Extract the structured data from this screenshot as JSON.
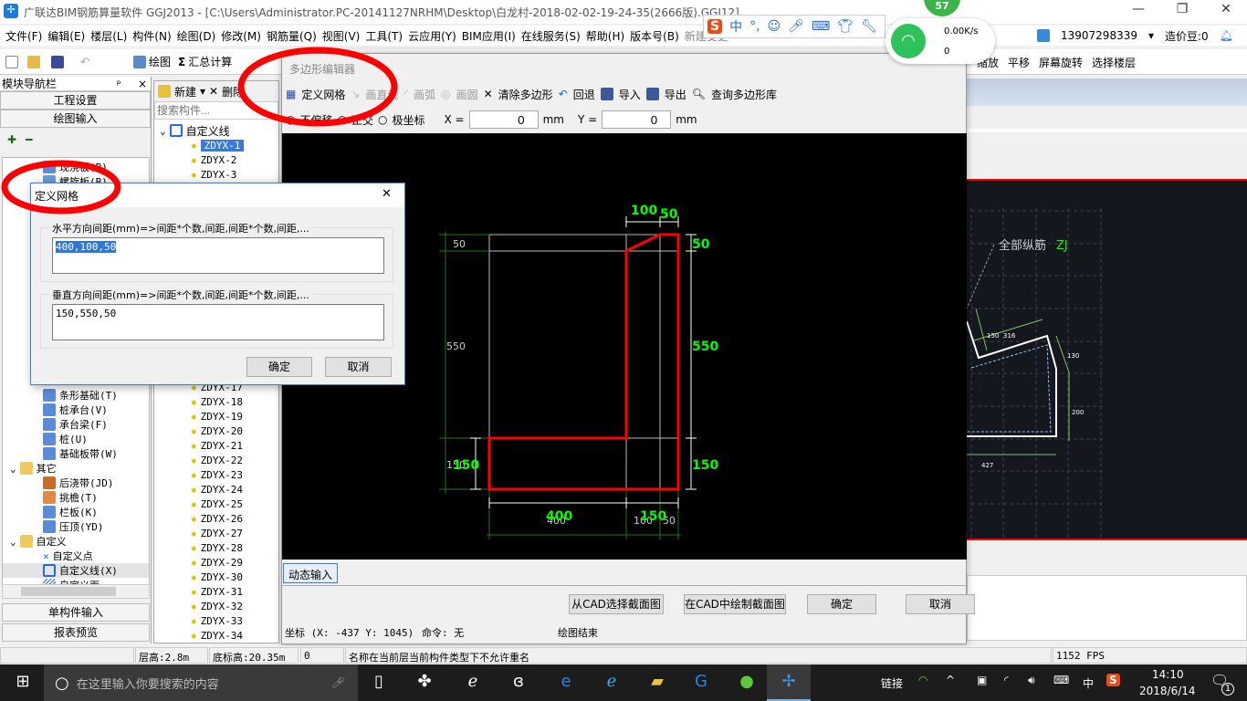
{
  "window": {
    "title": "广联达BIM钢筋算量软件 GGJ2013 - [C:\\Users\\Administrator.PC-20141127NRHM\\Desktop\\白龙村-2018-02-02-19-24-35(2666版).GGJ12]",
    "minimize": "—",
    "restore": "❐",
    "close": "✕"
  },
  "menu": [
    "文件(F)",
    "编辑(E)",
    "楼层(L)",
    "构件(N)",
    "绘图(D)",
    "修改(M)",
    "钢筋量(Q)",
    "视图(V)",
    "工具(T)",
    "云应用(Y)",
    "BIM应用(I)",
    "在线服务(S)",
    "帮助(H)",
    "版本号(B)",
    "新建变更"
  ],
  "account": {
    "phone": "13907298339",
    "beans": "造价豆:0"
  },
  "toolbar": {
    "draw": "绘图",
    "sum": "汇总计算",
    "right": [
      "平移",
      "屏幕旋转",
      "选择楼层"
    ],
    "right_partial": "缩放"
  },
  "nav": {
    "title": "模块导航栏",
    "pin": "ᵖ",
    "close": "×",
    "project_settings": "工程设置",
    "drawing_input": "绘图输入",
    "single_input": "单构件输入",
    "report_preview": "报表预览",
    "items": [
      {
        "label": "现浇板(B)",
        "level": 2
      },
      {
        "label": "螺旋板(B)",
        "level": 2
      },
      {
        "label": "条形基础(T)",
        "level": 2
      },
      {
        "label": "桩承台(V)",
        "level": 2
      },
      {
        "label": "承台梁(F)",
        "level": 2
      },
      {
        "label": "桩(U)",
        "level": 2
      },
      {
        "label": "基础板带(W)",
        "level": 2
      },
      {
        "label": "其它",
        "level": 1
      },
      {
        "label": "后浇带(JD)",
        "level": 2
      },
      {
        "label": "挑檐(T)",
        "level": 2
      },
      {
        "label": "栏板(K)",
        "level": 2
      },
      {
        "label": "压顶(YD)",
        "level": 2
      },
      {
        "label": "自定义",
        "level": 1
      },
      {
        "label": "自定义点",
        "level": 2
      },
      {
        "label": "自定义线(X)",
        "level": 2,
        "selected": true
      },
      {
        "label": "自定义面",
        "level": 2
      }
    ]
  },
  "list": {
    "new": "新建",
    "delete": "删除",
    "search_placeholder": "搜索构件...",
    "root": "自定义线",
    "items_top": [
      "ZDYX-1",
      "ZDYX-2",
      "ZDYX-3"
    ],
    "items": [
      "ZDYX-17",
      "ZDYX-18",
      "ZDYX-19",
      "ZDYX-20",
      "ZDYX-21",
      "ZDYX-22",
      "ZDYX-23",
      "ZDYX-24",
      "ZDYX-25",
      "ZDYX-26",
      "ZDYX-27",
      "ZDYX-28",
      "ZDYX-29",
      "ZDYX-30",
      "ZDYX-31",
      "ZDYX-32",
      "ZDYX-33",
      "ZDYX-34"
    ]
  },
  "editor": {
    "title": "多边形编辑器",
    "tools": {
      "define_grid": "定义网格",
      "line": "画直线",
      "arc": "画弧",
      "circle": "画圆",
      "clear": "清除多边形",
      "undo": "回退",
      "import": "导入",
      "export": "导出",
      "query": "查询多边形库"
    },
    "modes": {
      "none": "不偏移",
      "ortho": "正交",
      "polar": "极坐标"
    },
    "x_label": "X =",
    "x_value": "0",
    "y_label": "Y =",
    "y_value": "0",
    "unit": "mm",
    "dyn_input": "动态输入",
    "buttons": {
      "from_cad": "从CAD选择截面图",
      "draw_in_cad": "在CAD中绘制截面图",
      "ok": "确定",
      "cancel": "取消"
    },
    "status": {
      "coord": "坐标 (X: -437 Y: 1045)",
      "command": "命令: 无",
      "msg": "绘图结束"
    },
    "dims": {
      "top": [
        "100",
        "50"
      ],
      "left_white": [
        "50",
        "550",
        "150"
      ],
      "left_green": "150",
      "right": [
        "50",
        "550",
        "150"
      ],
      "bottom_green": [
        "400",
        "150"
      ],
      "bottom_white": [
        "400",
        "100",
        "50"
      ]
    }
  },
  "cad": {
    "label": "全部纵筋",
    "label_code": "ZJ",
    "dims": [
      "150",
      "316",
      "130",
      "200",
      "427"
    ]
  },
  "grid_dialog": {
    "title": "定义网格",
    "close": "✕",
    "h_label": "水平方向间距(mm)=>间距*个数,间距,间距*个数,间距,...",
    "h_value": "400,100,50",
    "v_label": "垂直方向间距(mm)=>间距*个数,间距,间距*个数,间距,...",
    "v_value": "150,550,50",
    "ok": "确定",
    "cancel": "取消"
  },
  "status": {
    "floor_height": "层高:2.8m",
    "base_elev": "底标高:20.35m",
    "num": "0",
    "message": "名称在当前层当前构件类型下不允许重名",
    "fps": "1152 FPS"
  },
  "ime": {
    "lang": "中",
    "punct": "°,"
  },
  "net": {
    "badge": "57",
    "speed": "0.00K/s",
    "count": "0"
  },
  "taskbar": {
    "search_placeholder": "在这里输入你要搜索的内容",
    "link": "链接",
    "lang": "中",
    "time": "14:10",
    "date": "2018/6/14",
    "notif": "1"
  },
  "colors": {
    "accent": "#0078d7",
    "red": "#ff0000",
    "green": "#00ff00",
    "cad_bg": "#14171e"
  }
}
